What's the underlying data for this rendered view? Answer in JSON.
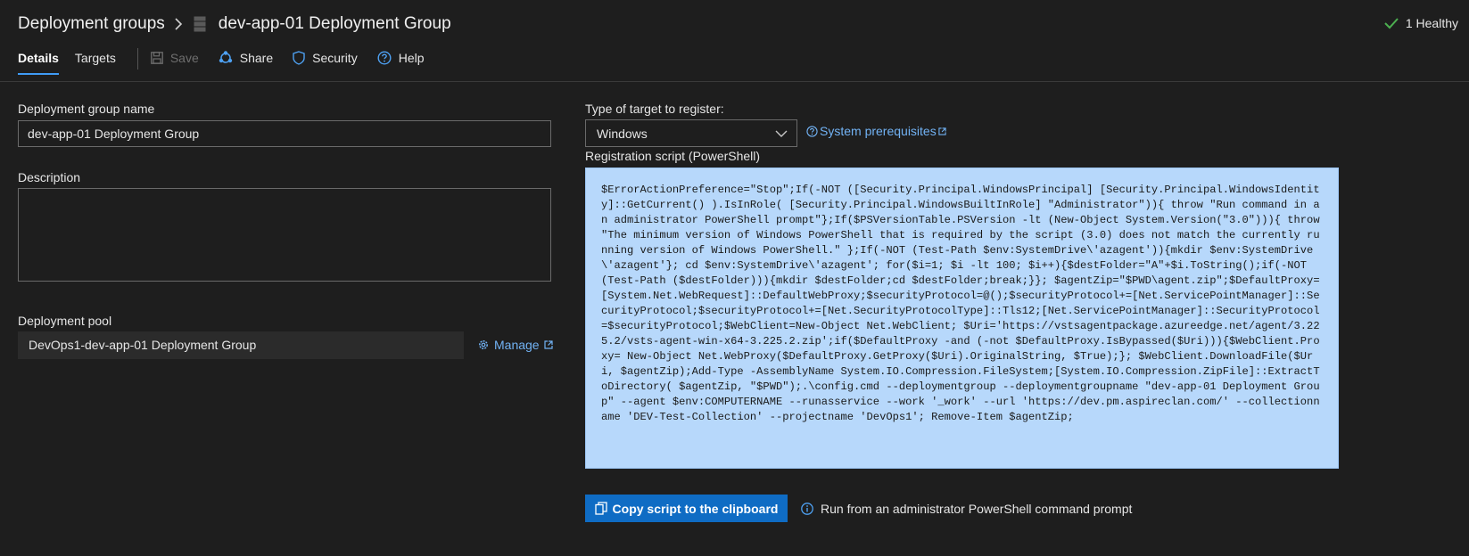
{
  "breadcrumb": {
    "root": "Deployment groups",
    "title": "dev-app-01 Deployment Group"
  },
  "status": {
    "text": "1 Healthy",
    "color": "#4caf50"
  },
  "tabs": [
    {
      "label": "Details",
      "active": true
    },
    {
      "label": "Targets",
      "active": false
    }
  ],
  "toolbar": {
    "save_label": "Save",
    "share_label": "Share",
    "security_label": "Security",
    "help_label": "Help"
  },
  "form": {
    "name_label": "Deployment group name",
    "name_value": "dev-app-01 Deployment Group",
    "description_label": "Description",
    "description_value": "",
    "pool_label": "Deployment pool",
    "pool_value": "DevOps1-dev-app-01 Deployment Group",
    "manage_label": "Manage"
  },
  "target": {
    "type_label": "Type of target to register:",
    "selected": "Windows",
    "prereq_label": "System prerequisites",
    "script_label": "Registration script (PowerShell)",
    "script": "$ErrorActionPreference=\"Stop\";If(-NOT ([Security.Principal.WindowsPrincipal] [Security.Principal.WindowsIdentity]::GetCurrent() ).IsInRole( [Security.Principal.WindowsBuiltInRole] \"Administrator\")){ throw \"Run command in an administrator PowerShell prompt\"};If($PSVersionTable.PSVersion -lt (New-Object System.Version(\"3.0\"))){ throw \"The minimum version of Windows PowerShell that is required by the script (3.0) does not match the currently running version of Windows PowerShell.\" };If(-NOT (Test-Path $env:SystemDrive\\'azagent')){mkdir $env:SystemDrive\\'azagent'}; cd $env:SystemDrive\\'azagent'; for($i=1; $i -lt 100; $i++){$destFolder=\"A\"+$i.ToString();if(-NOT (Test-Path ($destFolder))){mkdir $destFolder;cd $destFolder;break;}}; $agentZip=\"$PWD\\agent.zip\";$DefaultProxy=[System.Net.WebRequest]::DefaultWebProxy;$securityProtocol=@();$securityProtocol+=[Net.ServicePointManager]::SecurityProtocol;$securityProtocol+=[Net.SecurityProtocolType]::Tls12;[Net.ServicePointManager]::SecurityProtocol=$securityProtocol;$WebClient=New-Object Net.WebClient; $Uri='https://vstsagentpackage.azureedge.net/agent/3.225.2/vsts-agent-win-x64-3.225.2.zip';if($DefaultProxy -and (-not $DefaultProxy.IsBypassed($Uri))){$WebClient.Proxy= New-Object Net.WebProxy($DefaultProxy.GetProxy($Uri).OriginalString, $True);}; $WebClient.DownloadFile($Uri, $agentZip);Add-Type -AssemblyName System.IO.Compression.FileSystem;[System.IO.Compression.ZipFile]::ExtractToDirectory( $agentZip, \"$PWD\");.\\config.cmd --deploymentgroup --deploymentgroupname \"dev-app-01 Deployment Group\" --agent $env:COMPUTERNAME --runasservice --work '_work' --url 'https://dev.pm.aspireclan.com/' --collectionname 'DEV-Test-Collection' --projectname 'DevOps1'; Remove-Item $agentZip;",
    "copy_label": "Copy script to the clipboard",
    "info_text": "Run from an administrator PowerShell command prompt"
  },
  "colors": {
    "accent": "#0f6cc4",
    "link": "#72b3f5",
    "script_bg": "#b7d8fb",
    "healthy": "#4caf50"
  }
}
